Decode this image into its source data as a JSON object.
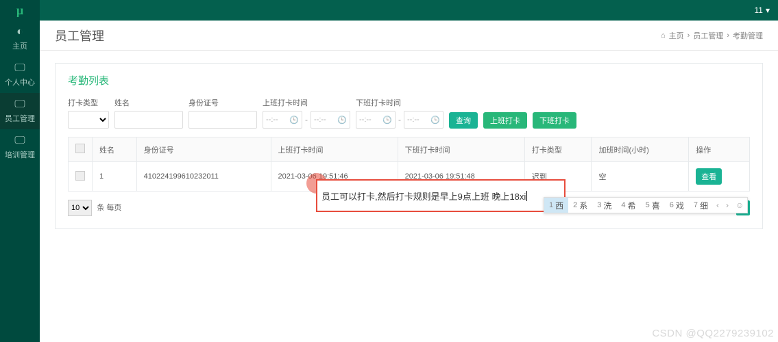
{
  "brand": "µ",
  "sidebar": {
    "items": [
      {
        "label": "主页",
        "icon": "◐"
      },
      {
        "label": "个人中心",
        "icon": "🖵"
      },
      {
        "label": "员工管理",
        "icon": "🖵"
      },
      {
        "label": "培训管理",
        "icon": "🖵"
      }
    ]
  },
  "topbar": {
    "user": "11",
    "caret": "▾"
  },
  "pageheader": {
    "title": "员工管理",
    "breadcrumb": {
      "home_icon": "⌂",
      "home": "主页",
      "sep": "›",
      "l1": "员工管理",
      "l2": "考勤管理"
    }
  },
  "card": {
    "title": "考勤列表"
  },
  "filters": {
    "type_label": "打卡类型",
    "name_label": "姓名",
    "idcard_label": "身份证号",
    "on_time_label": "上班打卡时间",
    "off_time_label": "下班打卡时间",
    "time_placeholder": "--:--",
    "dash": "-",
    "query_btn": "查询",
    "punch_on_btn": "上班打卡",
    "punch_off_btn": "下班打卡"
  },
  "table": {
    "headers": {
      "name": "姓名",
      "idcard": "身份证号",
      "on_time": "上班打卡时间",
      "off_time": "下班打卡时间",
      "type": "打卡类型",
      "overtime": "加班时间(小时)",
      "ops": "操作"
    },
    "rows": [
      {
        "name": "1",
        "idcard": "410224199610232011",
        "on_time": "2021-03-06 19:51:46",
        "off_time": "2021-03-06 19:51:48",
        "type": "迟到",
        "overtime": "空",
        "view": "查看"
      }
    ]
  },
  "footer": {
    "perpage_value": "10",
    "perpage_suffix": "条 每页",
    "page": "1"
  },
  "ime": {
    "composed_text": "员工可以打卡,然后打卡规则是早上9点上班  晚上18xi",
    "candidates": [
      {
        "n": "1",
        "w": "西"
      },
      {
        "n": "2",
        "w": "系"
      },
      {
        "n": "3",
        "w": "洗"
      },
      {
        "n": "4",
        "w": "希"
      },
      {
        "n": "5",
        "w": "喜"
      },
      {
        "n": "6",
        "w": "戏"
      },
      {
        "n": "7",
        "w": "细"
      }
    ],
    "prev": "‹",
    "next": "›",
    "emoji": "☺"
  },
  "watermark": "CSDN @QQ2279239102"
}
